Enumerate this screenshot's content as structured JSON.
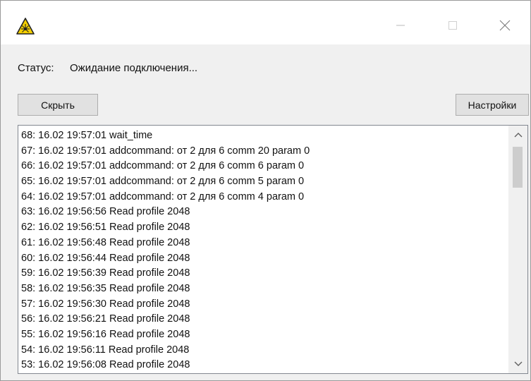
{
  "status": {
    "label": "Статус:",
    "value": "Ожидание подключения..."
  },
  "buttons": {
    "hide": "Скрыть",
    "settings": "Настройки"
  },
  "icons": {
    "app": "laser-warning-icon",
    "minimize": "minimize-icon",
    "maximize": "maximize-icon",
    "close": "close-icon",
    "scroll_up": "chevron-up-icon",
    "scroll_down": "chevron-down-icon"
  },
  "colors": {
    "warning_yellow": "#f5d000",
    "window_bg": "#f0f0f0",
    "button_bg": "#e1e1e1"
  },
  "log": [
    "68: 16.02 19:57:01 wait_time",
    "67: 16.02 19:57:01 addcommand: от 2 для 6 comm 20 param 0",
    "66: 16.02 19:57:01 addcommand: от 2 для 6 comm 6 param 0",
    "65: 16.02 19:57:01 addcommand: от 2 для 6 comm 5 param 0",
    "64: 16.02 19:57:01 addcommand: от 2 для 6 comm 4 param 0",
    "63: 16.02 19:56:56 Read profile 2048",
    "62: 16.02 19:56:51 Read profile 2048",
    "61: 16.02 19:56:48 Read profile 2048",
    "60: 16.02 19:56:44 Read profile 2048",
    "59: 16.02 19:56:39 Read profile 2048",
    "58: 16.02 19:56:35 Read profile 2048",
    "57: 16.02 19:56:30 Read profile 2048",
    "56: 16.02 19:56:21 Read profile 2048",
    "55: 16.02 19:56:16 Read profile 2048",
    "54: 16.02 19:56:11 Read profile 2048",
    "53: 16.02 19:56:08 Read profile 2048"
  ]
}
